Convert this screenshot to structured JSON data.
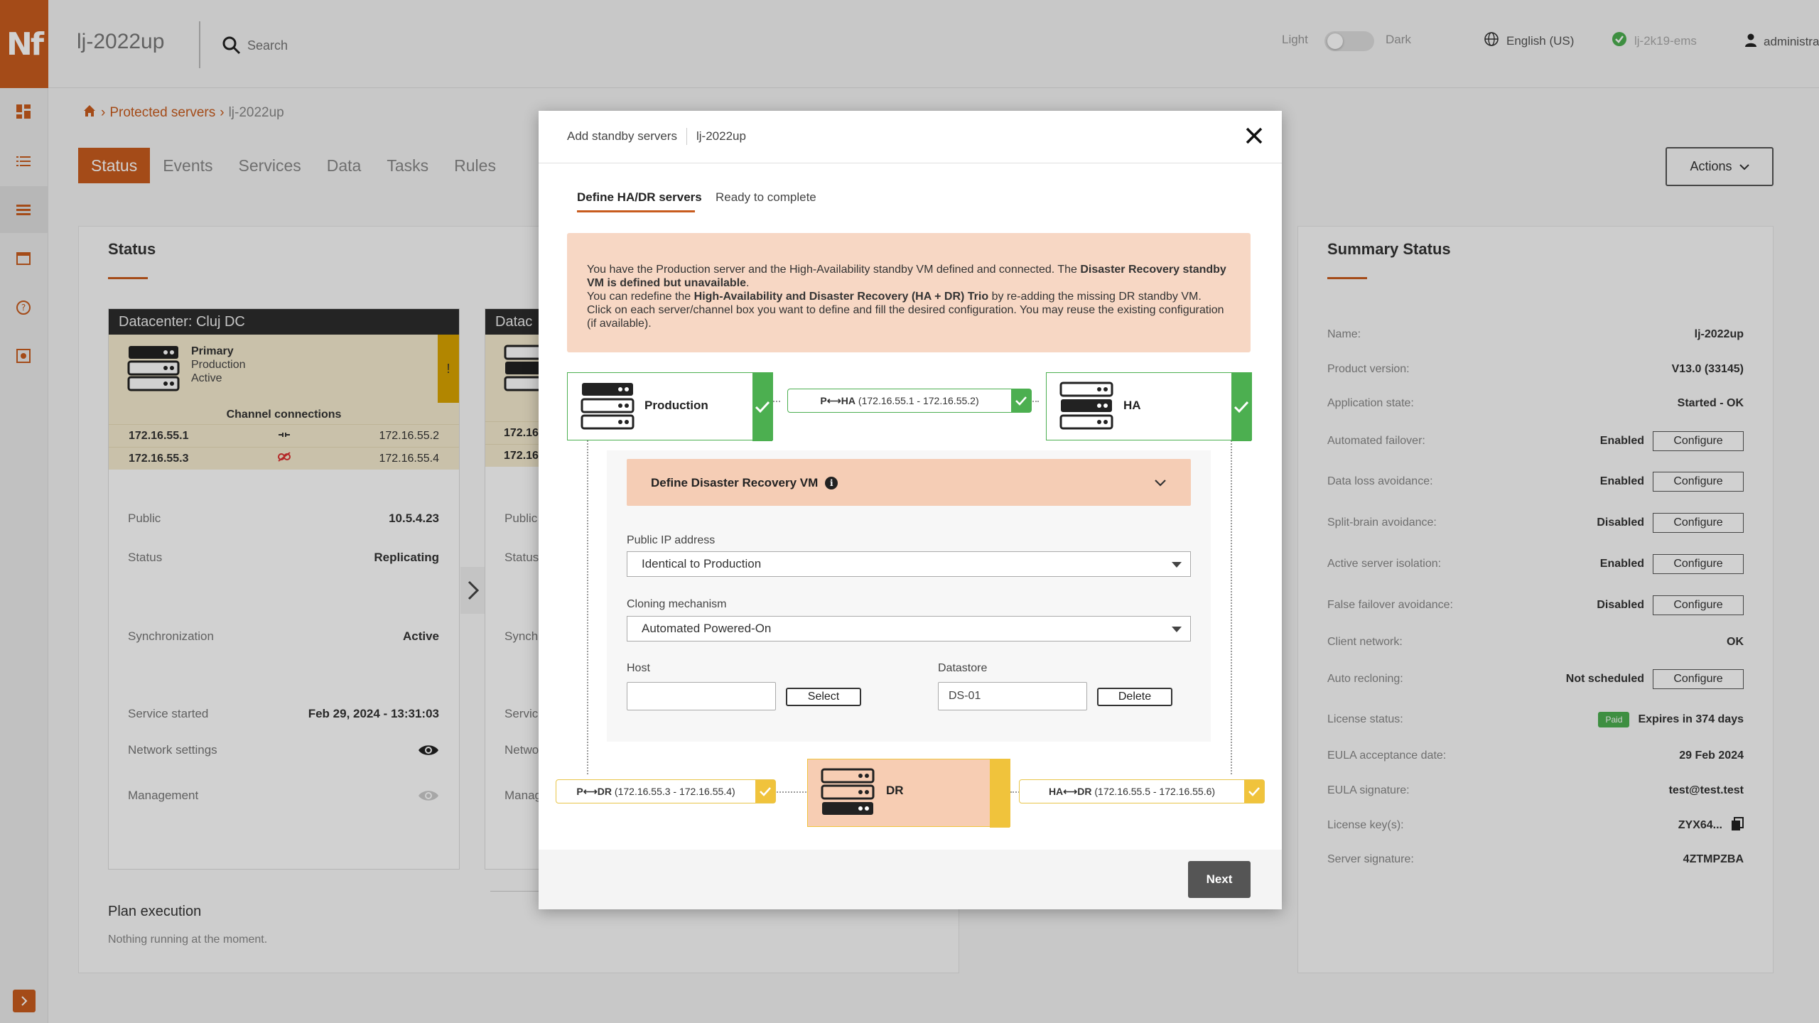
{
  "app": {
    "logo_text": "Nf",
    "title": "lj-2022up",
    "search_placeholder": "Search",
    "theme_light": "Light",
    "theme_dark": "Dark",
    "language": "English (US)",
    "server": "lj-2k19-ems",
    "user": "administrator"
  },
  "breadcrumb": {
    "link": "Protected servers",
    "current": "lj-2022up"
  },
  "tabs": [
    "Status",
    "Events",
    "Services",
    "Data",
    "Tasks",
    "Rules"
  ],
  "actions_label": "Actions",
  "status_panel": {
    "title": "Status",
    "datacenter": "Datacenter: Cluj DC",
    "datacenter2_short": "Datac",
    "server_role": "Primary",
    "server_type": "Production",
    "server_state": "Active",
    "warning_mark": "!",
    "channel_title": "Channel connections",
    "channels": [
      {
        "left": "172.16.55.1",
        "right": "172.16.55.2"
      },
      {
        "left": "172.16.55.3",
        "right": "172.16.55.4"
      }
    ],
    "channels2_short": [
      "172.16",
      "172.16"
    ],
    "rows": [
      {
        "label": "Public",
        "value": "10.5.4.23"
      },
      {
        "label": "Status",
        "value": "Replicating"
      },
      {
        "label": "Synchronization",
        "value": "Active"
      },
      {
        "label": "Service started",
        "value": "Feb 29, 2024 - 13:31:03"
      },
      {
        "label": "Network settings",
        "value": ""
      },
      {
        "label": "Management",
        "value": ""
      }
    ],
    "rows2_short": [
      "Public",
      "Status",
      "Synch",
      "Servic",
      "Netwo",
      "Manag"
    ]
  },
  "plan": {
    "title": "Plan execution",
    "text": "Nothing running at the moment."
  },
  "summary": {
    "title": "Summary Status",
    "configure_label": "Configure",
    "rows": [
      {
        "label": "Name:",
        "value": "lj-2022up"
      },
      {
        "label": "Product version:",
        "value": "V13.0 (33145)"
      },
      {
        "label": "Application state:",
        "value": "Started - OK"
      },
      {
        "label": "Automated failover:",
        "value": "Enabled",
        "configure": true
      },
      {
        "label": "Data loss avoidance:",
        "value": "Enabled",
        "configure": true
      },
      {
        "label": "Split-brain avoidance:",
        "value": "Disabled",
        "configure": true
      },
      {
        "label": "Active server isolation:",
        "value": "Enabled",
        "configure": true
      },
      {
        "label": "False failover avoidance:",
        "value": "Disabled",
        "configure": true
      },
      {
        "label": "Client network:",
        "value": "OK"
      },
      {
        "label": "Auto recloning:",
        "value": "Not scheduled",
        "configure": true
      },
      {
        "label": "License status:",
        "value": "Expires in 374 days",
        "badge": "Paid"
      },
      {
        "label": "EULA acceptance date:",
        "value": "29 Feb 2024"
      },
      {
        "label": "EULA signature:",
        "value": "test@test.test"
      },
      {
        "label": "License key(s):",
        "value": "ZYX64..."
      },
      {
        "label": "Server signature:",
        "value": "4ZTMPZBA"
      }
    ]
  },
  "modal": {
    "title": "Add standby servers",
    "subtitle": "lj-2022up",
    "tabs": [
      "Define HA/DR servers",
      "Ready to complete"
    ],
    "alert": {
      "line1_pre": "You have the Production server and the High-Availability standby VM defined and connected. The ",
      "line1_bold": "Disaster Recovery standby VM is defined but unavailable",
      "line1_post": ".",
      "line2_pre": "You can redefine the ",
      "line2_bold": "High-Availability and Disaster Recovery (HA + DR) Trio",
      "line2_post": " by re-adding the missing DR standby VM.",
      "line3": "Click on each server/channel box you want to define and fill the desired configuration. You may reuse the existing configuration (if available)."
    },
    "nodes": {
      "production": "Production",
      "ha": "HA",
      "dr": "DR"
    },
    "links": {
      "p_ha_label": "P",
      "p_ha_target": "HA",
      "p_ha_ips": "(172.16.55.1 - 172.16.55.2)",
      "p_dr_label": "P",
      "p_dr_target": "DR",
      "p_dr_ips": "(172.16.55.3 - 172.16.55.4)",
      "ha_dr_label": "HA",
      "ha_dr_target": "DR",
      "ha_dr_ips": "(172.16.55.5 - 172.16.55.6)"
    },
    "dr_section": {
      "title": "Define Disaster Recovery VM",
      "public_ip_label": "Public IP address",
      "public_ip_value": "Identical to Production",
      "cloning_label": "Cloning mechanism",
      "cloning_value": "Automated Powered-On",
      "host_label": "Host",
      "host_value": "",
      "select_label": "Select",
      "datastore_label": "Datastore",
      "datastore_value": "DS-01",
      "delete_label": "Delete"
    },
    "next_label": "Next"
  },
  "colors": {
    "accent": "#c85c1e",
    "success": "#4caf50",
    "warning": "#f0c33c",
    "alert_bg": "#f7d7c4"
  }
}
